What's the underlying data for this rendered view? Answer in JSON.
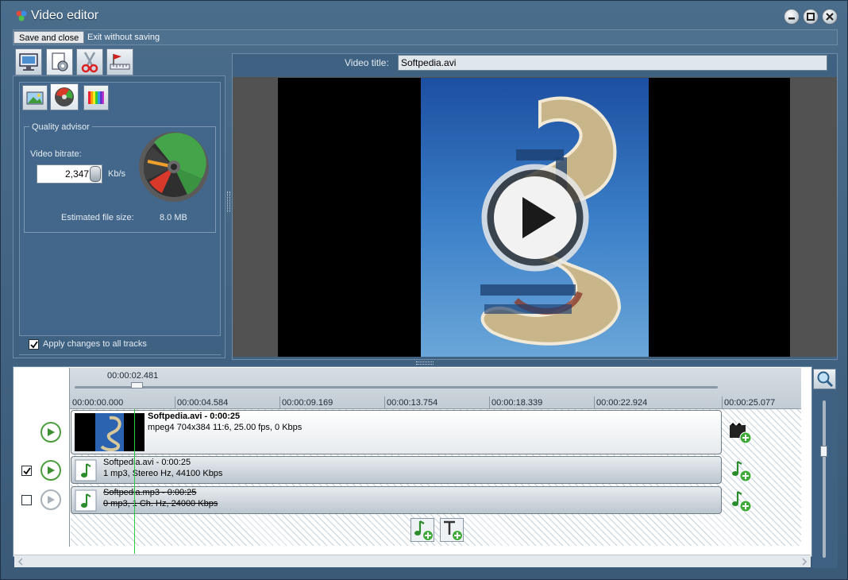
{
  "window": {
    "title": "Video editor"
  },
  "menu": {
    "save_close": "Save and close",
    "exit_without_saving": "Exit without saving"
  },
  "quality": {
    "group_title": "Quality advisor",
    "bitrate_label": "Video bitrate:",
    "bitrate_value": "2,347",
    "bitrate_unit": "Kb/s",
    "file_size_label": "Estimated file size:",
    "file_size_value": "8.0 MB",
    "apply_label": "Apply changes to all tracks",
    "apply_checked": true
  },
  "preview": {
    "title_label": "Video title:",
    "title_value": "Softpedia.avi"
  },
  "timeline": {
    "current_time": "00:00:02.481",
    "ruler": [
      "00:00:00.000",
      "00:00:04.584",
      "00:00:09.169",
      "00:00:13.754",
      "00:00:18.339",
      "00:00:22.924",
      "00:00:25.077"
    ],
    "tracks": [
      {
        "name": "Softpedia.avi - 0:00:25",
        "details": "mpeg4 704x384 11:6, 25.00 fps, 0 Kbps"
      },
      {
        "name": "Softpedia.avi - 0:00:25",
        "details": "1 mp3, Stereo Hz, 44100 Kbps",
        "checked": true
      },
      {
        "name": "Softpedia.mp3 - 0:00:25",
        "details": "0 mp3, 1 Ch. Hz, 24000 Kbps",
        "checked": false
      }
    ]
  },
  "colors": {
    "panel": "#43678a",
    "accent_green": "#4a9f3c",
    "playhead": "#2ecc40"
  }
}
